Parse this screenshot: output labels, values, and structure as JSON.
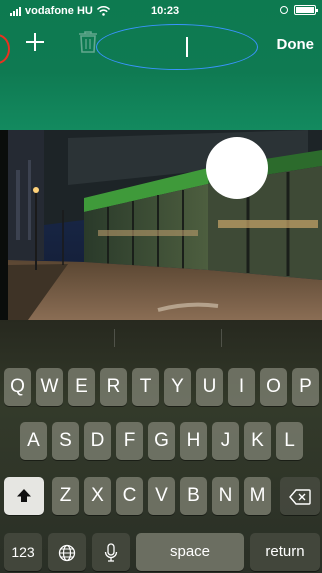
{
  "status_bar": {
    "carrier": "vodafone HU",
    "time": "10:23",
    "icons": [
      "signal-icon",
      "wifi-icon",
      "rotation-lock-icon",
      "battery-icon"
    ]
  },
  "toolbar": {
    "add_icon": "plus-icon",
    "delete_icon": "trash-icon",
    "done_label": "Done",
    "text_field_value": "",
    "annotation_color": "#3a94ff"
  },
  "photo": {
    "description_icon": "photo",
    "marker_color": "#ffffff"
  },
  "keyboard": {
    "row1": [
      "Q",
      "W",
      "E",
      "R",
      "T",
      "Y",
      "U",
      "I",
      "O",
      "P"
    ],
    "row2": [
      "A",
      "S",
      "D",
      "F",
      "G",
      "H",
      "J",
      "K",
      "L"
    ],
    "row3": [
      "Z",
      "X",
      "C",
      "V",
      "B",
      "N",
      "M"
    ],
    "shift_icon": "shift-icon",
    "delete_icon": "backspace-icon",
    "numbers_label": "123",
    "globe_icon": "globe-icon",
    "mic_icon": "microphone-icon",
    "space_label": "space",
    "return_label": "return"
  },
  "colors": {
    "toolbar_green": "#0f7a52",
    "annotation_red": "#e8321f"
  }
}
